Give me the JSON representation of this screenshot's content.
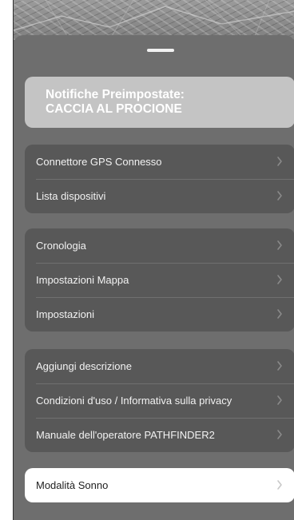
{
  "preset": {
    "line1": "Notifiche Preimpostate:",
    "line2": "CACCIA AL PROCIONE"
  },
  "groups": [
    {
      "items": [
        {
          "label": "Connettore GPS Connesso"
        },
        {
          "label": "Lista dispositivi"
        }
      ]
    },
    {
      "items": [
        {
          "label": "Cronologia"
        },
        {
          "label": "Impostazioni Mappa"
        },
        {
          "label": "Impostazioni"
        }
      ]
    },
    {
      "items": [
        {
          "label": "Aggiungi descrizione"
        },
        {
          "label": "Condizioni d'uso / Informativa sulla privacy"
        },
        {
          "label": "Manuale dell'operatore PATHFINDER2"
        }
      ]
    }
  ],
  "sleep": {
    "label": "Modalità Sonno"
  },
  "icons": {
    "row_chevron": "chevron-right-icon",
    "handle": "drag-handle"
  },
  "colors": {
    "sheet": "#6e6e6e",
    "group": "#585858",
    "preset_card": "#c4c4c4",
    "sleep_card": "#ffffff"
  }
}
